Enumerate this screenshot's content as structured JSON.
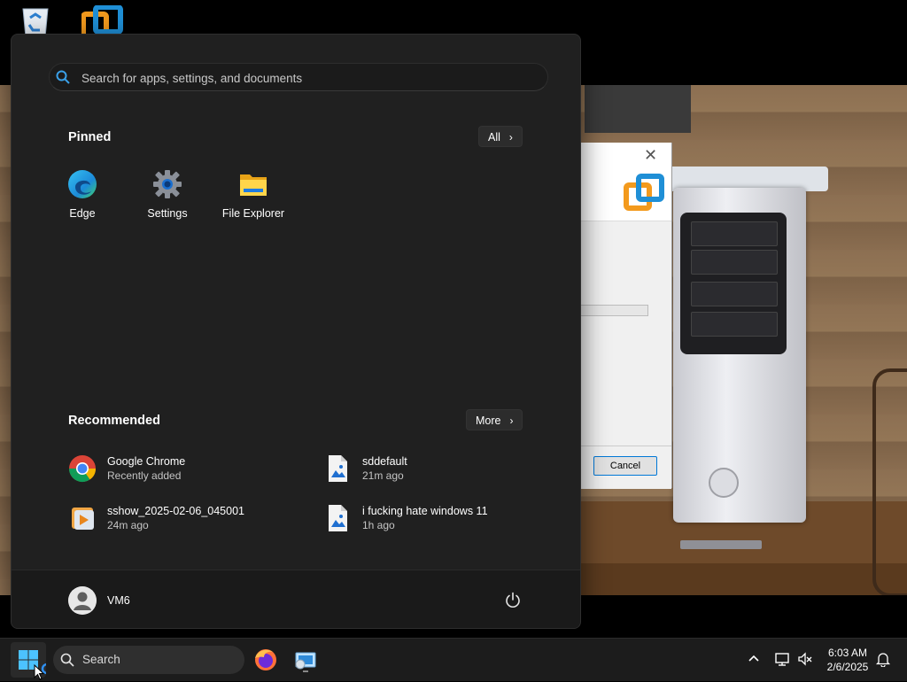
{
  "start_menu": {
    "search": {
      "placeholder": "Search for apps, settings, and documents"
    },
    "pinned": {
      "title": "Pinned",
      "all_button": "All",
      "apps": [
        {
          "label": "Edge",
          "icon": "edge-icon"
        },
        {
          "label": "Settings",
          "icon": "gear-icon"
        },
        {
          "label": "File Explorer",
          "icon": "folder-icon"
        }
      ]
    },
    "recommended": {
      "title": "Recommended",
      "more_button": "More",
      "items": [
        {
          "name": "Google Chrome",
          "sub": "Recently added",
          "icon": "chrome-icon"
        },
        {
          "name": "sddefault",
          "sub": "21m ago",
          "icon": "image-file-icon"
        },
        {
          "name": "sshow_2025-02-06_045001",
          "sub": "24m ago",
          "icon": "video-file-icon"
        },
        {
          "name": "i fucking hate windows 11",
          "sub": "1h ago",
          "icon": "image-file-icon"
        }
      ]
    },
    "user": {
      "name": "VM6"
    }
  },
  "dialog": {
    "cancel_label": "Cancel"
  },
  "taskbar": {
    "search_label": "Search",
    "clock": {
      "time": "6:03 AM",
      "date": "2/6/2025"
    }
  },
  "colors": {
    "accent": "#0078d4",
    "menu_bg": "#202020",
    "taskbar_bg": "#1c1c1c"
  }
}
